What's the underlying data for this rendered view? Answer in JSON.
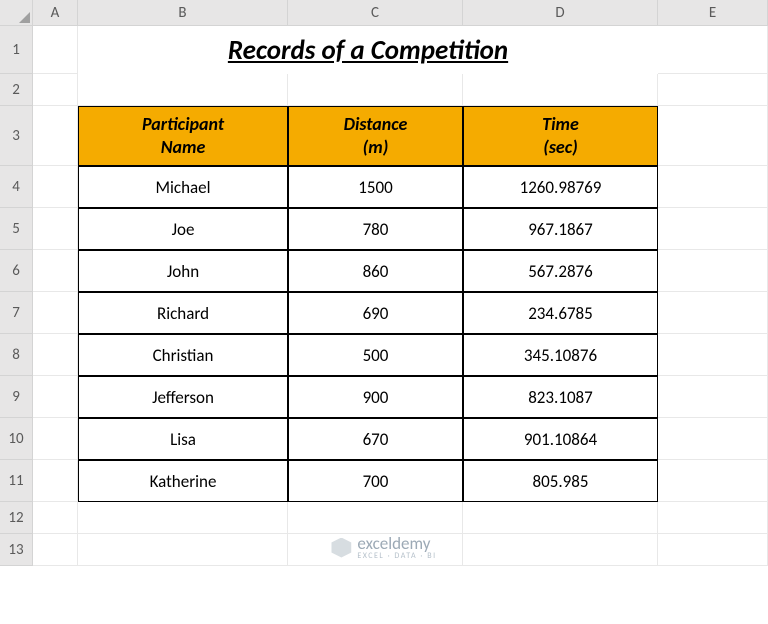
{
  "columns": [
    "A",
    "B",
    "C",
    "D",
    "E"
  ],
  "rows": [
    "1",
    "2",
    "3",
    "4",
    "5",
    "6",
    "7",
    "8",
    "9",
    "10",
    "11",
    "12",
    "13"
  ],
  "title": "Records of a Competition",
  "headers": {
    "col1": "Participant\nName",
    "col2": "Distance\n(m)",
    "col3": "Time\n(sec)"
  },
  "data": [
    {
      "name": "Michael",
      "dist": "1500",
      "time": "1260.98769"
    },
    {
      "name": "Joe",
      "dist": "780",
      "time": "967.1867"
    },
    {
      "name": "John",
      "dist": "860",
      "time": "567.2876"
    },
    {
      "name": "Richard",
      "dist": "690",
      "time": "234.6785"
    },
    {
      "name": "Christian",
      "dist": "500",
      "time": "345.10876"
    },
    {
      "name": "Jefferson",
      "dist": "900",
      "time": "823.1087"
    },
    {
      "name": "Lisa",
      "dist": "670",
      "time": "901.10864"
    },
    {
      "name": "Katherine",
      "dist": "700",
      "time": "805.985"
    }
  ],
  "watermark": {
    "brand": "exceldemy",
    "tag": "EXCEL · DATA · BI"
  },
  "colors": {
    "headerFill": "#f5ab00",
    "border": "#000"
  },
  "chart_data": {
    "type": "table",
    "title": "Records of a Competition",
    "columns": [
      "Participant Name",
      "Distance (m)",
      "Time (sec)"
    ],
    "rows": [
      [
        "Michael",
        1500,
        1260.98769
      ],
      [
        "Joe",
        780,
        967.1867
      ],
      [
        "John",
        860,
        567.2876
      ],
      [
        "Richard",
        690,
        234.6785
      ],
      [
        "Christian",
        500,
        345.10876
      ],
      [
        "Jefferson",
        900,
        823.1087
      ],
      [
        "Lisa",
        670,
        901.10864
      ],
      [
        "Katherine",
        700,
        805.985
      ]
    ]
  }
}
